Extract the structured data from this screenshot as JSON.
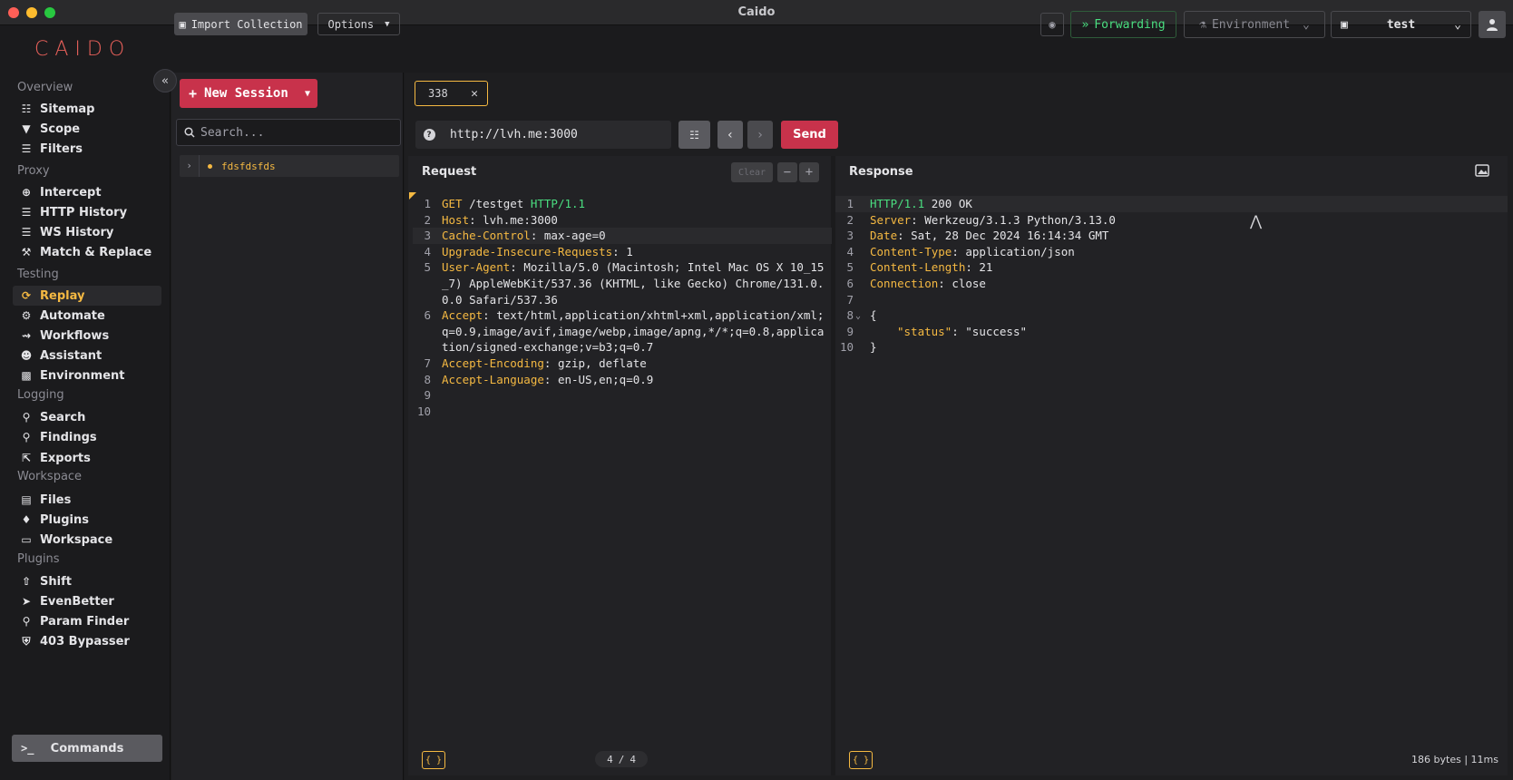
{
  "window": {
    "title": "Caido"
  },
  "topbar": {
    "logo": "CAIDO",
    "import_label": "Import Collection",
    "options_label": "Options",
    "forwarding_label": "Forwarding",
    "environment_label": "Environment",
    "project_label": "test"
  },
  "sidebar": {
    "sections": {
      "overview": "Overview",
      "proxy": "Proxy",
      "testing": "Testing",
      "logging": "Logging",
      "workspace": "Workspace",
      "plugins": "Plugins"
    },
    "items": {
      "sitemap": "Sitemap",
      "scope": "Scope",
      "filters": "Filters",
      "intercept": "Intercept",
      "http_history": "HTTP History",
      "ws_history": "WS History",
      "match_replace": "Match & Replace",
      "replay": "Replay",
      "automate": "Automate",
      "workflows": "Workflows",
      "assistant": "Assistant",
      "environment": "Environment",
      "search": "Search",
      "findings": "Findings",
      "exports": "Exports",
      "files": "Files",
      "plugins": "Plugins",
      "workspace": "Workspace",
      "shift": "Shift",
      "evenbetter": "EvenBetter",
      "param_finder": "Param Finder",
      "bypasser": "403 Bypasser"
    },
    "commands_label": "Commands",
    "active": "replay"
  },
  "sessions": {
    "new_session_label": "New Session",
    "search_placeholder": "Search...",
    "items": [
      {
        "name": "fdsfdsfds"
      }
    ]
  },
  "replay": {
    "tab_label": "338",
    "url": "http://lvh.me:3000",
    "send_label": "Send"
  },
  "request": {
    "title": "Request",
    "clear_label": "Clear",
    "line_numbers": [
      "1",
      "2",
      "3",
      "4",
      "5",
      "6",
      "7",
      "8",
      "9",
      "10"
    ],
    "lines": {
      "l1_method": "GET",
      "l1_path": " /testget ",
      "l1_version": "HTTP/1.1",
      "l2_key": "Host",
      "l2_val": ": lvh.me:3000",
      "l3_key": "Cache-Control",
      "l3_val": ": max-age=0",
      "l4_key": "Upgrade-Insecure-Requests",
      "l4_val": ": 1",
      "l5_key": "User-Agent",
      "l5_val": ": Mozilla/5.0 (Macintosh; Intel Mac OS X 10_15",
      "l5_wrap1": "_7) AppleWebKit/537.36 (KHTML, like Gecko) Chrome/131.0.",
      "l5_wrap2": "0.0 Safari/537.36",
      "l6_key": "Accept",
      "l6_val": ": text/html,application/xhtml+xml,application/xml;",
      "l6_wrap1": "q=0.9,image/avif,image/webp,image/apng,*/*;q=0.8,applica",
      "l6_wrap2": "tion/signed-exchange;v=b3;q=0.7",
      "l7_key": "Accept-Encoding",
      "l7_val": ": gzip, deflate",
      "l8_key": "Accept-Language",
      "l8_val": ": en-US,en;q=0.9"
    },
    "pager_current": "4",
    "pager_sep": "/",
    "pager_total": "4",
    "badge": "{ }"
  },
  "response": {
    "title": "Response",
    "line_numbers": [
      "1",
      "2",
      "3",
      "4",
      "5",
      "6",
      "7",
      "8",
      "9",
      "10"
    ],
    "lines": {
      "l1_version": "HTTP/1.1",
      "l1_status": " 200 OK",
      "l2_key": "Server",
      "l2_val": ": Werkzeug/3.1.3 Python/3.13.0",
      "l3_key": "Date",
      "l3_val": ": Sat, 28 Dec 2024 16:14:34 GMT",
      "l4_key": "Content-Type",
      "l4_val": ": application/json",
      "l5_key": "Content-Length",
      "l5_val": ": 21",
      "l6_key": "Connection",
      "l6_val": ": close",
      "l8": "{",
      "l9_key": "\"status\"",
      "l9_val": ": \"success\"",
      "l10": "}"
    },
    "stats": "186 bytes | 11ms",
    "badge": "{ }"
  },
  "colors": {
    "accent": "#f5b942",
    "primary": "#c8324b",
    "success": "#4ade80",
    "logo": "#e8605a"
  }
}
